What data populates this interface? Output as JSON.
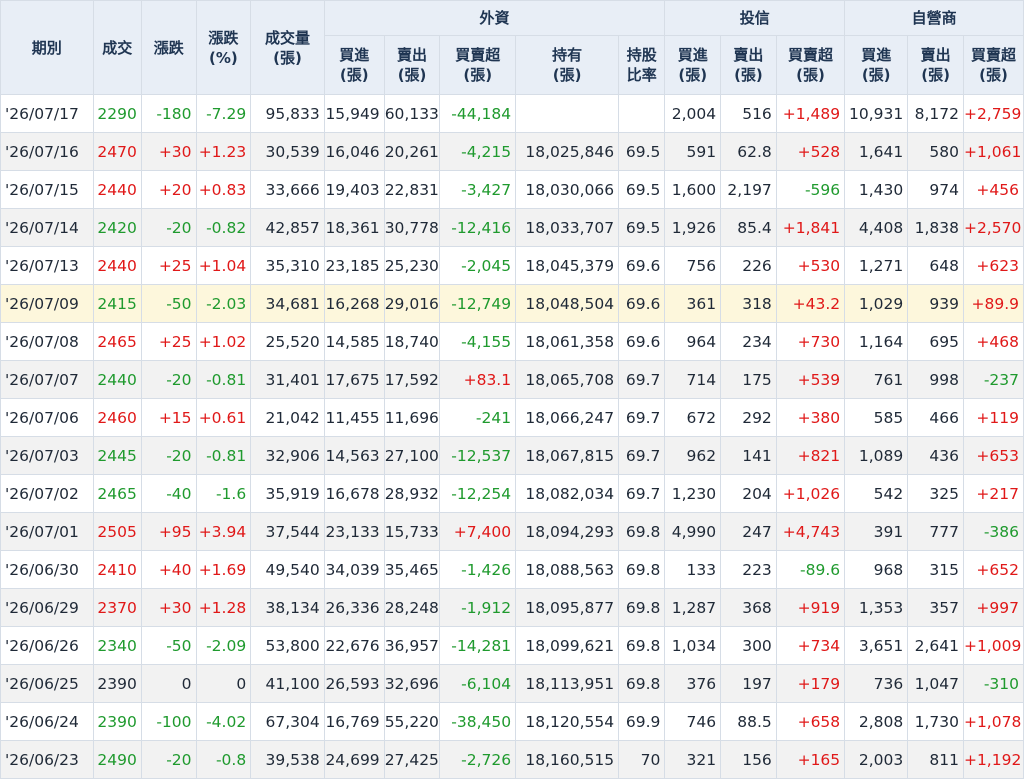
{
  "headers": {
    "date": "期別",
    "price": "成交",
    "change": "漲跌",
    "change_pct": [
      "漲跌",
      "(%)"
    ],
    "volume": [
      "成交量",
      "(張)"
    ],
    "groups": {
      "foreign": "外資",
      "trust": "投信",
      "dealer": "自營商"
    },
    "buy": [
      "買進",
      "(張)"
    ],
    "sell": [
      "賣出",
      "(張)"
    ],
    "net": [
      "買賣超",
      "(張)"
    ],
    "holdings": [
      "持有",
      "(張)"
    ],
    "holding_ratio": [
      "持股",
      "比率"
    ]
  },
  "colors": {
    "up": "#e01818",
    "down": "#1f9a2e",
    "header_bg": "#e8eef6",
    "highlight_row": "#fdf7dc"
  },
  "rows": [
    {
      "date": "'26/07/17",
      "price": "2290",
      "change": "-180",
      "change_pct": "-7.29",
      "volume": "95,833",
      "f_buy": "15,949",
      "f_sell": "60,133",
      "f_net": "-44,184",
      "f_hold": "",
      "f_ratio": "",
      "t_buy": "2,004",
      "t_sell": "516",
      "t_net": "+1,489",
      "d_buy": "10,931",
      "d_sell": "8,172",
      "d_net": "+2,759"
    },
    {
      "date": "'26/07/16",
      "price": "2470",
      "change": "+30",
      "change_pct": "+1.23",
      "volume": "30,539",
      "f_buy": "16,046",
      "f_sell": "20,261",
      "f_net": "-4,215",
      "f_hold": "18,025,846",
      "f_ratio": "69.5",
      "t_buy": "591",
      "t_sell": "62.8",
      "t_net": "+528",
      "d_buy": "1,641",
      "d_sell": "580",
      "d_net": "+1,061"
    },
    {
      "date": "'26/07/15",
      "price": "2440",
      "change": "+20",
      "change_pct": "+0.83",
      "volume": "33,666",
      "f_buy": "19,403",
      "f_sell": "22,831",
      "f_net": "-3,427",
      "f_hold": "18,030,066",
      "f_ratio": "69.5",
      "t_buy": "1,600",
      "t_sell": "2,197",
      "t_net": "-596",
      "d_buy": "1,430",
      "d_sell": "974",
      "d_net": "+456"
    },
    {
      "date": "'26/07/14",
      "price": "2420",
      "change": "-20",
      "change_pct": "-0.82",
      "volume": "42,857",
      "f_buy": "18,361",
      "f_sell": "30,778",
      "f_net": "-12,416",
      "f_hold": "18,033,707",
      "f_ratio": "69.5",
      "t_buy": "1,926",
      "t_sell": "85.4",
      "t_net": "+1,841",
      "d_buy": "4,408",
      "d_sell": "1,838",
      "d_net": "+2,570"
    },
    {
      "date": "'26/07/13",
      "price": "2440",
      "change": "+25",
      "change_pct": "+1.04",
      "volume": "35,310",
      "f_buy": "23,185",
      "f_sell": "25,230",
      "f_net": "-2,045",
      "f_hold": "18,045,379",
      "f_ratio": "69.6",
      "t_buy": "756",
      "t_sell": "226",
      "t_net": "+530",
      "d_buy": "1,271",
      "d_sell": "648",
      "d_net": "+623"
    },
    {
      "date": "'26/07/09",
      "price": "2415",
      "change": "-50",
      "change_pct": "-2.03",
      "volume": "34,681",
      "f_buy": "16,268",
      "f_sell": "29,016",
      "f_net": "-12,749",
      "f_hold": "18,048,504",
      "f_ratio": "69.6",
      "t_buy": "361",
      "t_sell": "318",
      "t_net": "+43.2",
      "d_buy": "1,029",
      "d_sell": "939",
      "d_net": "+89.9",
      "highlight": true
    },
    {
      "date": "'26/07/08",
      "price": "2465",
      "change": "+25",
      "change_pct": "+1.02",
      "volume": "25,520",
      "f_buy": "14,585",
      "f_sell": "18,740",
      "f_net": "-4,155",
      "f_hold": "18,061,358",
      "f_ratio": "69.6",
      "t_buy": "964",
      "t_sell": "234",
      "t_net": "+730",
      "d_buy": "1,164",
      "d_sell": "695",
      "d_net": "+468"
    },
    {
      "date": "'26/07/07",
      "price": "2440",
      "change": "-20",
      "change_pct": "-0.81",
      "volume": "31,401",
      "f_buy": "17,675",
      "f_sell": "17,592",
      "f_net": "+83.1",
      "f_hold": "18,065,708",
      "f_ratio": "69.7",
      "t_buy": "714",
      "t_sell": "175",
      "t_net": "+539",
      "d_buy": "761",
      "d_sell": "998",
      "d_net": "-237"
    },
    {
      "date": "'26/07/06",
      "price": "2460",
      "change": "+15",
      "change_pct": "+0.61",
      "volume": "21,042",
      "f_buy": "11,455",
      "f_sell": "11,696",
      "f_net": "-241",
      "f_hold": "18,066,247",
      "f_ratio": "69.7",
      "t_buy": "672",
      "t_sell": "292",
      "t_net": "+380",
      "d_buy": "585",
      "d_sell": "466",
      "d_net": "+119"
    },
    {
      "date": "'26/07/03",
      "price": "2445",
      "change": "-20",
      "change_pct": "-0.81",
      "volume": "32,906",
      "f_buy": "14,563",
      "f_sell": "27,100",
      "f_net": "-12,537",
      "f_hold": "18,067,815",
      "f_ratio": "69.7",
      "t_buy": "962",
      "t_sell": "141",
      "t_net": "+821",
      "d_buy": "1,089",
      "d_sell": "436",
      "d_net": "+653"
    },
    {
      "date": "'26/07/02",
      "price": "2465",
      "change": "-40",
      "change_pct": "-1.6",
      "volume": "35,919",
      "f_buy": "16,678",
      "f_sell": "28,932",
      "f_net": "-12,254",
      "f_hold": "18,082,034",
      "f_ratio": "69.7",
      "t_buy": "1,230",
      "t_sell": "204",
      "t_net": "+1,026",
      "d_buy": "542",
      "d_sell": "325",
      "d_net": "+217"
    },
    {
      "date": "'26/07/01",
      "price": "2505",
      "change": "+95",
      "change_pct": "+3.94",
      "volume": "37,544",
      "f_buy": "23,133",
      "f_sell": "15,733",
      "f_net": "+7,400",
      "f_hold": "18,094,293",
      "f_ratio": "69.8",
      "t_buy": "4,990",
      "t_sell": "247",
      "t_net": "+4,743",
      "d_buy": "391",
      "d_sell": "777",
      "d_net": "-386"
    },
    {
      "date": "'26/06/30",
      "price": "2410",
      "change": "+40",
      "change_pct": "+1.69",
      "volume": "49,540",
      "f_buy": "34,039",
      "f_sell": "35,465",
      "f_net": "-1,426",
      "f_hold": "18,088,563",
      "f_ratio": "69.8",
      "t_buy": "133",
      "t_sell": "223",
      "t_net": "-89.6",
      "d_buy": "968",
      "d_sell": "315",
      "d_net": "+652"
    },
    {
      "date": "'26/06/29",
      "price": "2370",
      "change": "+30",
      "change_pct": "+1.28",
      "volume": "38,134",
      "f_buy": "26,336",
      "f_sell": "28,248",
      "f_net": "-1,912",
      "f_hold": "18,095,877",
      "f_ratio": "69.8",
      "t_buy": "1,287",
      "t_sell": "368",
      "t_net": "+919",
      "d_buy": "1,353",
      "d_sell": "357",
      "d_net": "+997"
    },
    {
      "date": "'26/06/26",
      "price": "2340",
      "change": "-50",
      "change_pct": "-2.09",
      "volume": "53,800",
      "f_buy": "22,676",
      "f_sell": "36,957",
      "f_net": "-14,281",
      "f_hold": "18,099,621",
      "f_ratio": "69.8",
      "t_buy": "1,034",
      "t_sell": "300",
      "t_net": "+734",
      "d_buy": "3,651",
      "d_sell": "2,641",
      "d_net": "+1,009"
    },
    {
      "date": "'26/06/25",
      "price": "2390",
      "change": "0",
      "change_pct": "0",
      "volume": "41,100",
      "f_buy": "26,593",
      "f_sell": "32,696",
      "f_net": "-6,104",
      "f_hold": "18,113,951",
      "f_ratio": "69.8",
      "t_buy": "376",
      "t_sell": "197",
      "t_net": "+179",
      "d_buy": "736",
      "d_sell": "1,047",
      "d_net": "-310"
    },
    {
      "date": "'26/06/24",
      "price": "2390",
      "change": "-100",
      "change_pct": "-4.02",
      "volume": "67,304",
      "f_buy": "16,769",
      "f_sell": "55,220",
      "f_net": "-38,450",
      "f_hold": "18,120,554",
      "f_ratio": "69.9",
      "t_buy": "746",
      "t_sell": "88.5",
      "t_net": "+658",
      "d_buy": "2,808",
      "d_sell": "1,730",
      "d_net": "+1,078"
    },
    {
      "date": "'26/06/23",
      "price": "2490",
      "change": "-20",
      "change_pct": "-0.8",
      "volume": "39,538",
      "f_buy": "24,699",
      "f_sell": "27,425",
      "f_net": "-2,726",
      "f_hold": "18,160,515",
      "f_ratio": "70",
      "t_buy": "321",
      "t_sell": "156",
      "t_net": "+165",
      "d_buy": "2,003",
      "d_sell": "811",
      "d_net": "+1,192"
    }
  ]
}
